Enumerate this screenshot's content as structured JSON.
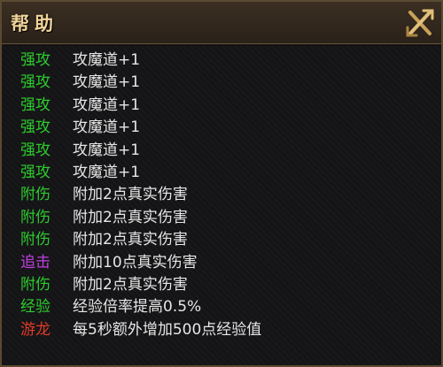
{
  "window": {
    "title": "帮助"
  },
  "rows": [
    {
      "tag": "强攻",
      "desc": "攻魔道+1",
      "color": "#2ecc2e"
    },
    {
      "tag": "强攻",
      "desc": "攻魔道+1",
      "color": "#2ecc2e"
    },
    {
      "tag": "强攻",
      "desc": "攻魔道+1",
      "color": "#2ecc2e"
    },
    {
      "tag": "强攻",
      "desc": "攻魔道+1",
      "color": "#2ecc2e"
    },
    {
      "tag": "强攻",
      "desc": "攻魔道+1",
      "color": "#2ecc2e"
    },
    {
      "tag": "强攻",
      "desc": "攻魔道+1",
      "color": "#2ecc2e"
    },
    {
      "tag": "附伤",
      "desc": "附加2点真实伤害",
      "color": "#2ecc2e"
    },
    {
      "tag": "附伤",
      "desc": "附加2点真实伤害",
      "color": "#2ecc2e"
    },
    {
      "tag": "附伤",
      "desc": "附加2点真实伤害",
      "color": "#2ecc2e"
    },
    {
      "tag": "追击",
      "desc": "附加10点真实伤害",
      "color": "#c040e0"
    },
    {
      "tag": "附伤",
      "desc": "附加2点真实伤害",
      "color": "#2ecc2e"
    },
    {
      "tag": "经验",
      "desc": "经验倍率提高0.5%",
      "color": "#2ecc2e"
    },
    {
      "tag": "游龙",
      "desc": "每5秒额外增加500点经验值",
      "color": "#e43a2a"
    }
  ]
}
